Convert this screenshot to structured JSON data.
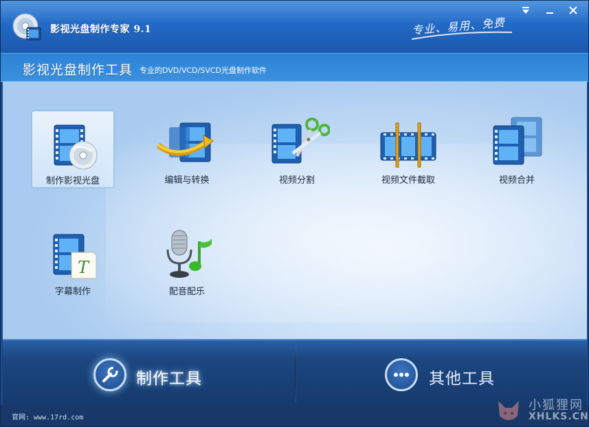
{
  "window": {
    "title": "影视光盘制作专家 9.1",
    "slogan": "专业、易用、免费",
    "controls": {
      "menu": "▾",
      "minimize": "—",
      "close": "✕"
    }
  },
  "subheader": {
    "title": "影视光盘制作工具",
    "description": "专业的DVD/VCD/SVCD光盘制作软件"
  },
  "tools": [
    {
      "label": "制作影视光盘",
      "icon": "film-disc-icon",
      "selected": true
    },
    {
      "label": "编辑与转换",
      "icon": "film-convert-icon",
      "selected": false
    },
    {
      "label": "视频分割",
      "icon": "film-scissors-icon",
      "selected": false
    },
    {
      "label": "视频文件截取",
      "icon": "film-clip-icon",
      "selected": false
    },
    {
      "label": "视频合并",
      "icon": "film-merge-icon",
      "selected": false
    },
    {
      "label": "字幕制作",
      "icon": "film-subtitle-icon",
      "selected": false
    },
    {
      "label": "配音配乐",
      "icon": "microphone-music-icon",
      "selected": false
    }
  ],
  "tabs": [
    {
      "label": "制作工具",
      "icon": "wrench-icon",
      "active": true
    },
    {
      "label": "其他工具",
      "icon": "ellipsis-icon",
      "active": false
    }
  ],
  "footer": {
    "text": "官网: www.17rd.com"
  },
  "watermark": {
    "cn": "小狐狸网",
    "en": "XHLKS.CN"
  },
  "colors": {
    "accent": "#2269c6",
    "tab_bar": "#1b467f",
    "content_bg": "#cfe3f8"
  }
}
